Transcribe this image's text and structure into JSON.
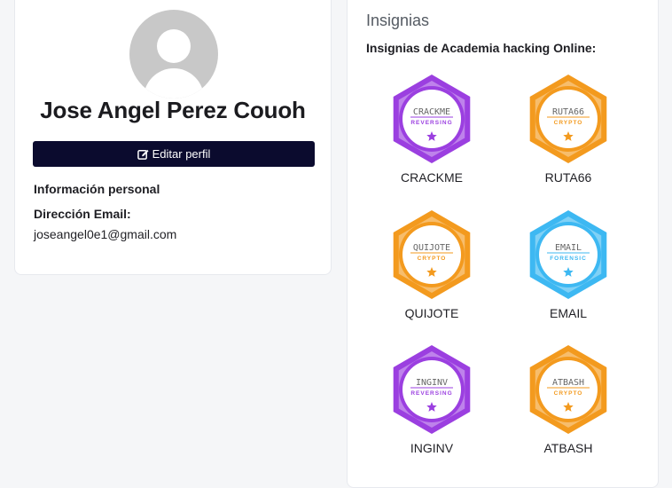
{
  "profile": {
    "name": "Jose Angel Perez Couoh",
    "edit_label": "Editar perfil",
    "personal_info_heading": "Información personal",
    "email_label": "Dirección Email:",
    "email": "joseangel0e1@gmail.com"
  },
  "badges": {
    "title": "Insignias",
    "subtitle": "Insignias de Academia hacking Online:",
    "items": [
      {
        "name": "CRACKME",
        "badge_text": "CRACKME",
        "category": "REVERSING",
        "color": "#9b3fe0",
        "icon": "star-icon"
      },
      {
        "name": "RUTA66",
        "badge_text": "RUTA66",
        "category": "CRYPTO",
        "color": "#f39a1e",
        "icon": "star-icon"
      },
      {
        "name": "QUIJOTE",
        "badge_text": "QUIJOTE",
        "category": "CRYPTO",
        "color": "#f39a1e",
        "icon": "star-icon"
      },
      {
        "name": "EMAIL",
        "badge_text": "EMAIL",
        "category": "FORENSIC",
        "color": "#3db8f2",
        "icon": "star-icon"
      },
      {
        "name": "INGINV",
        "badge_text": "INGINV",
        "category": "REVERSING",
        "color": "#9b3fe0",
        "icon": "star-icon"
      },
      {
        "name": "ATBASH",
        "badge_text": "ATBASH",
        "category": "CRYPTO",
        "color": "#f39a1e",
        "icon": "star-icon"
      }
    ]
  }
}
